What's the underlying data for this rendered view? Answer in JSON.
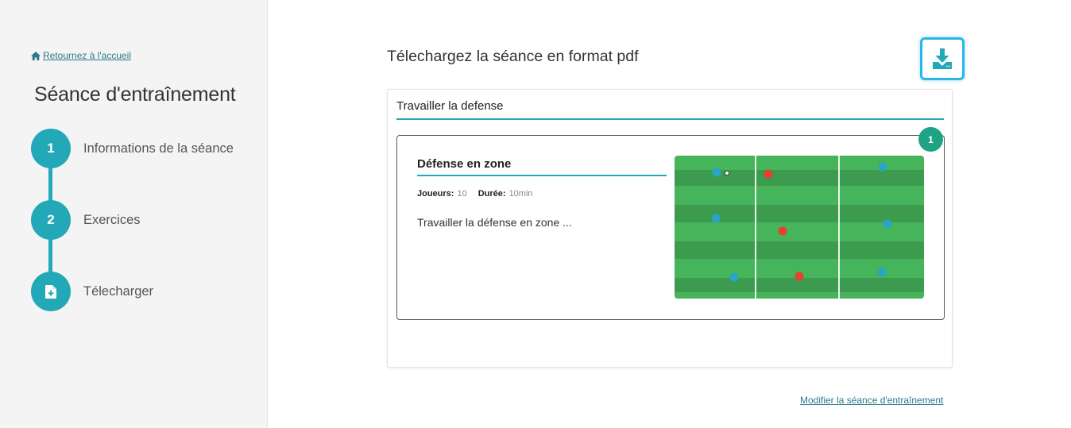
{
  "sidebar": {
    "home_link": "Retournez à l'accueil",
    "title": "Séance d'entraînement",
    "steps": [
      {
        "number": "1",
        "label": "Informations de la séance"
      },
      {
        "number": "2",
        "label": "Exercices"
      },
      {
        "icon": "file-download-icon",
        "label": "Télecharger"
      }
    ]
  },
  "main": {
    "title": "Télechargez la séance en format pdf",
    "download_icon": "download-icon",
    "panel_title": "Travailler la defense",
    "exercise": {
      "badge": "1",
      "title": "Défense en zone",
      "players_label": "Joueurs:",
      "players_value": "10",
      "duration_label": "Durée:",
      "duration_value": "10min",
      "description": "Travailler la défense en zone ..."
    },
    "edit_link": "Modifier la séance d'entraînement"
  },
  "colors": {
    "accent": "#23a8b8",
    "badge": "#1fa385",
    "download_border": "#2ab6e6",
    "pitch_light": "#45b45a",
    "pitch_dark": "#3c9b4f",
    "team_blue": "#2aa5c8",
    "team_red": "#e8402f"
  }
}
